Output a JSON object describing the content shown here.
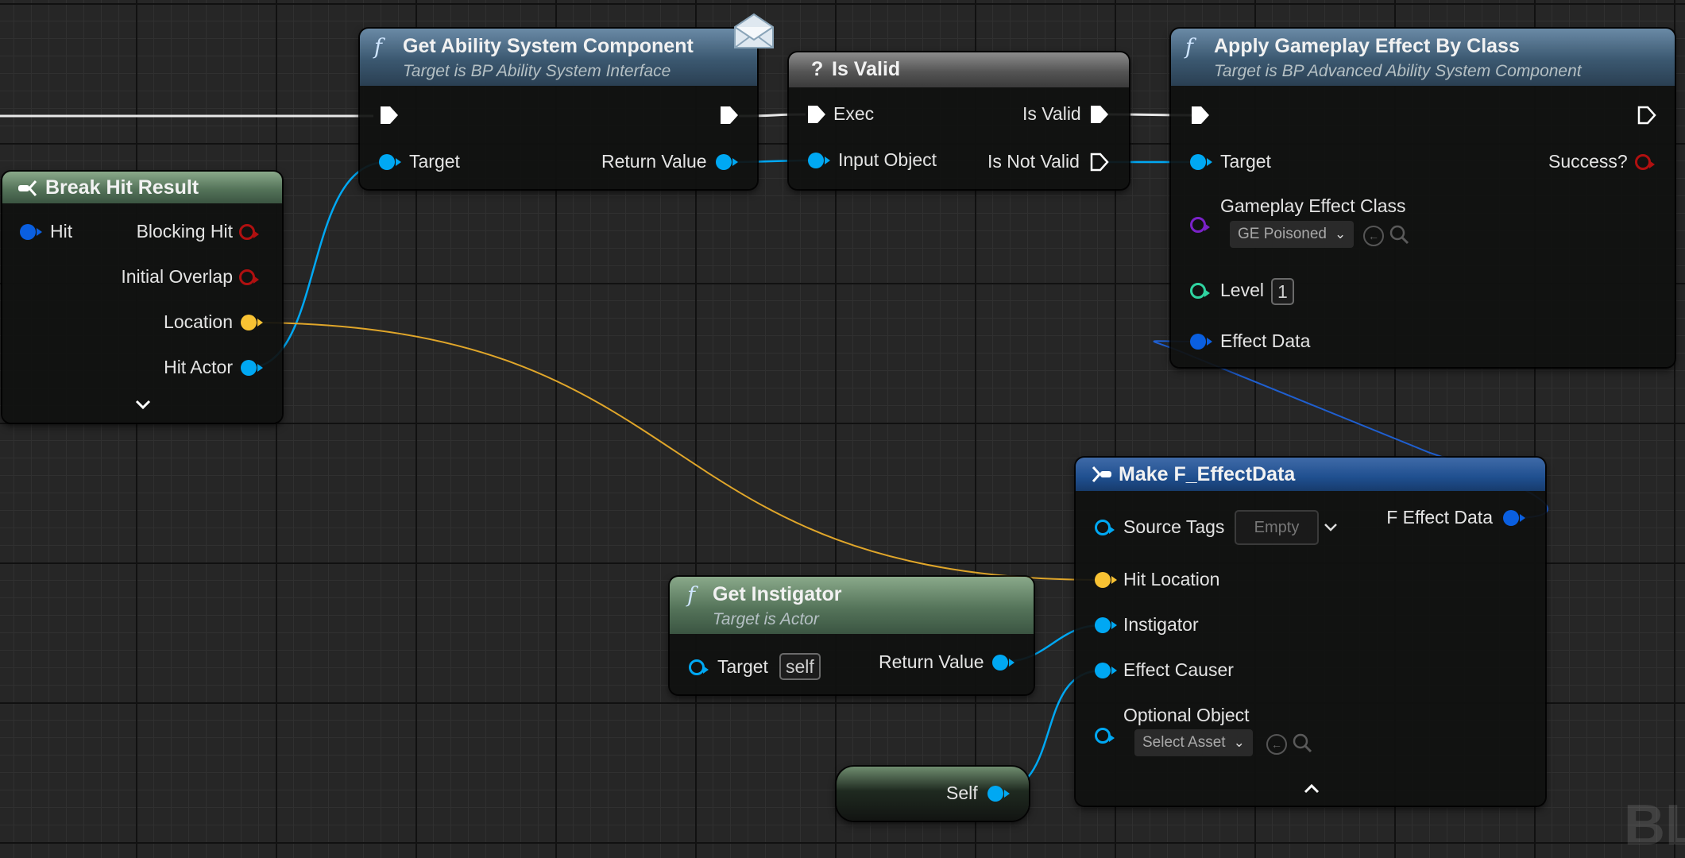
{
  "nodes": {
    "get_asc": {
      "title": "Get Ability System Component",
      "subtitle": "Target is BP Ability System Interface",
      "pin_target": "Target",
      "pin_return": "Return Value"
    },
    "is_valid": {
      "title": "Is Valid",
      "pin_exec": "Exec",
      "pin_input": "Input Object",
      "pin_is_valid": "Is Valid",
      "pin_is_not_valid": "Is Not Valid"
    },
    "apply_ge": {
      "title": "Apply Gameplay Effect By Class",
      "subtitle": "Target is BP Advanced Ability System Component",
      "pin_target": "Target",
      "pin_success": "Success?",
      "pin_ge_class": "Gameplay Effect Class",
      "ge_class_value": "GE Poisoned",
      "pin_level": "Level",
      "level_value": "1",
      "pin_effect_data": "Effect Data"
    },
    "break_hit": {
      "title": "Break Hit Result",
      "pin_hit": "Hit",
      "pin_blocking": "Blocking Hit",
      "pin_initial": "Initial Overlap",
      "pin_location": "Location",
      "pin_hit_actor": "Hit Actor"
    },
    "make_fed": {
      "title": "Make F_EffectData",
      "pin_source_tags": "Source Tags",
      "source_tags_value": "Empty",
      "pin_out": "F Effect Data",
      "pin_hit_location": "Hit Location",
      "pin_instigator": "Instigator",
      "pin_effect_causer": "Effect Causer",
      "pin_optional": "Optional Object",
      "optional_value": "Select Asset"
    },
    "get_instigator": {
      "title": "Get Instigator",
      "subtitle": "Target is Actor",
      "pin_target": "Target",
      "target_value": "self",
      "pin_return": "Return Value"
    },
    "self_node": {
      "label": "Self"
    }
  },
  "watermark": "BL",
  "colors": {
    "object_pin": "#00a8f3",
    "struct_pin": "#0a5fe0",
    "vector_pin": "#f8c233",
    "bool_pin": "#b01010",
    "class_pin": "#7a22c8",
    "int_pin": "#2fd3a0",
    "exec_pin": "#ffffff"
  }
}
